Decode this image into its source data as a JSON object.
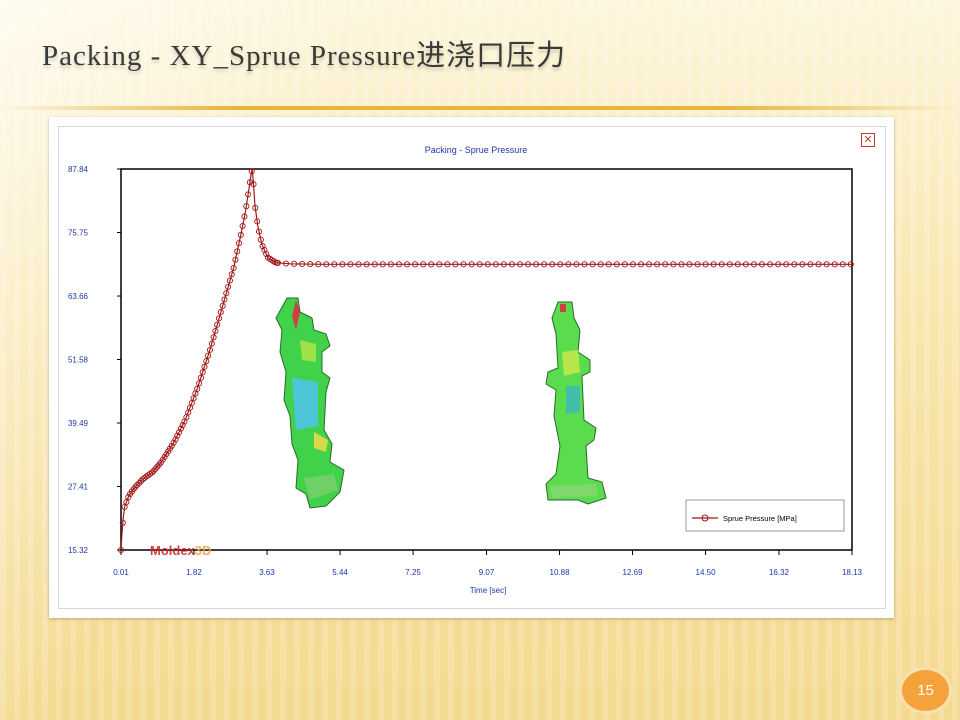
{
  "slide": {
    "title": "Packing - XY_Sprue Pressure进浇口压力",
    "page_number": "15"
  },
  "icons": {
    "close": "close-icon"
  },
  "watermark": {
    "brand": "Moldex",
    "suffix": "3D"
  },
  "colors": {
    "series": "#a01818",
    "axis_text": "#1f36a8",
    "title_text": "#3a3a3a",
    "watermark_red": "#cc2222",
    "watermark_orange": "#f2a24a",
    "badge": "#f6a23a"
  },
  "chart_data": {
    "type": "line",
    "title": "Packing - Sprue Pressure",
    "xlabel": "Time [sec]",
    "ylabel": "",
    "xlim": [
      0.01,
      18.13
    ],
    "ylim": [
      15.32,
      87.84
    ],
    "x_ticks": [
      "0.01",
      "1.82",
      "3.63",
      "5.44",
      "7.25",
      "9.07",
      "10.88",
      "12.69",
      "14.50",
      "16.32",
      "18.13"
    ],
    "y_ticks": [
      "87.84",
      "75.75",
      "63.66",
      "51.58",
      "39.49",
      "27.41",
      "15.32"
    ],
    "legend": {
      "position": "bottom-right",
      "entries": [
        "Sprue Pressure [MPa]"
      ]
    },
    "grid": false,
    "series": [
      {
        "name": "Sprue Pressure [MPa]",
        "marker": "circle",
        "curve": [
          [
            0.01,
            15.32
          ],
          [
            0.03,
            18.0
          ],
          [
            0.06,
            21.0
          ],
          [
            0.1,
            23.5
          ],
          [
            0.2,
            25.6
          ],
          [
            0.35,
            27.2
          ],
          [
            0.55,
            28.8
          ],
          [
            0.8,
            30.2
          ],
          [
            1.0,
            32.0
          ],
          [
            1.3,
            35.5
          ],
          [
            1.6,
            40.0
          ],
          [
            1.9,
            46.0
          ],
          [
            2.2,
            53.0
          ],
          [
            2.5,
            61.0
          ],
          [
            2.8,
            69.0
          ],
          [
            3.0,
            76.0
          ],
          [
            3.1,
            80.0
          ],
          [
            3.18,
            84.0
          ],
          [
            3.23,
            86.6
          ],
          [
            3.26,
            87.84
          ],
          [
            3.29,
            85.5
          ],
          [
            3.33,
            81.0
          ],
          [
            3.4,
            77.0
          ],
          [
            3.5,
            73.5
          ],
          [
            3.65,
            71.0
          ],
          [
            3.85,
            70.0
          ],
          [
            4.2,
            69.8
          ],
          [
            5.0,
            69.7
          ],
          [
            18.13,
            69.7
          ]
        ]
      }
    ]
  }
}
